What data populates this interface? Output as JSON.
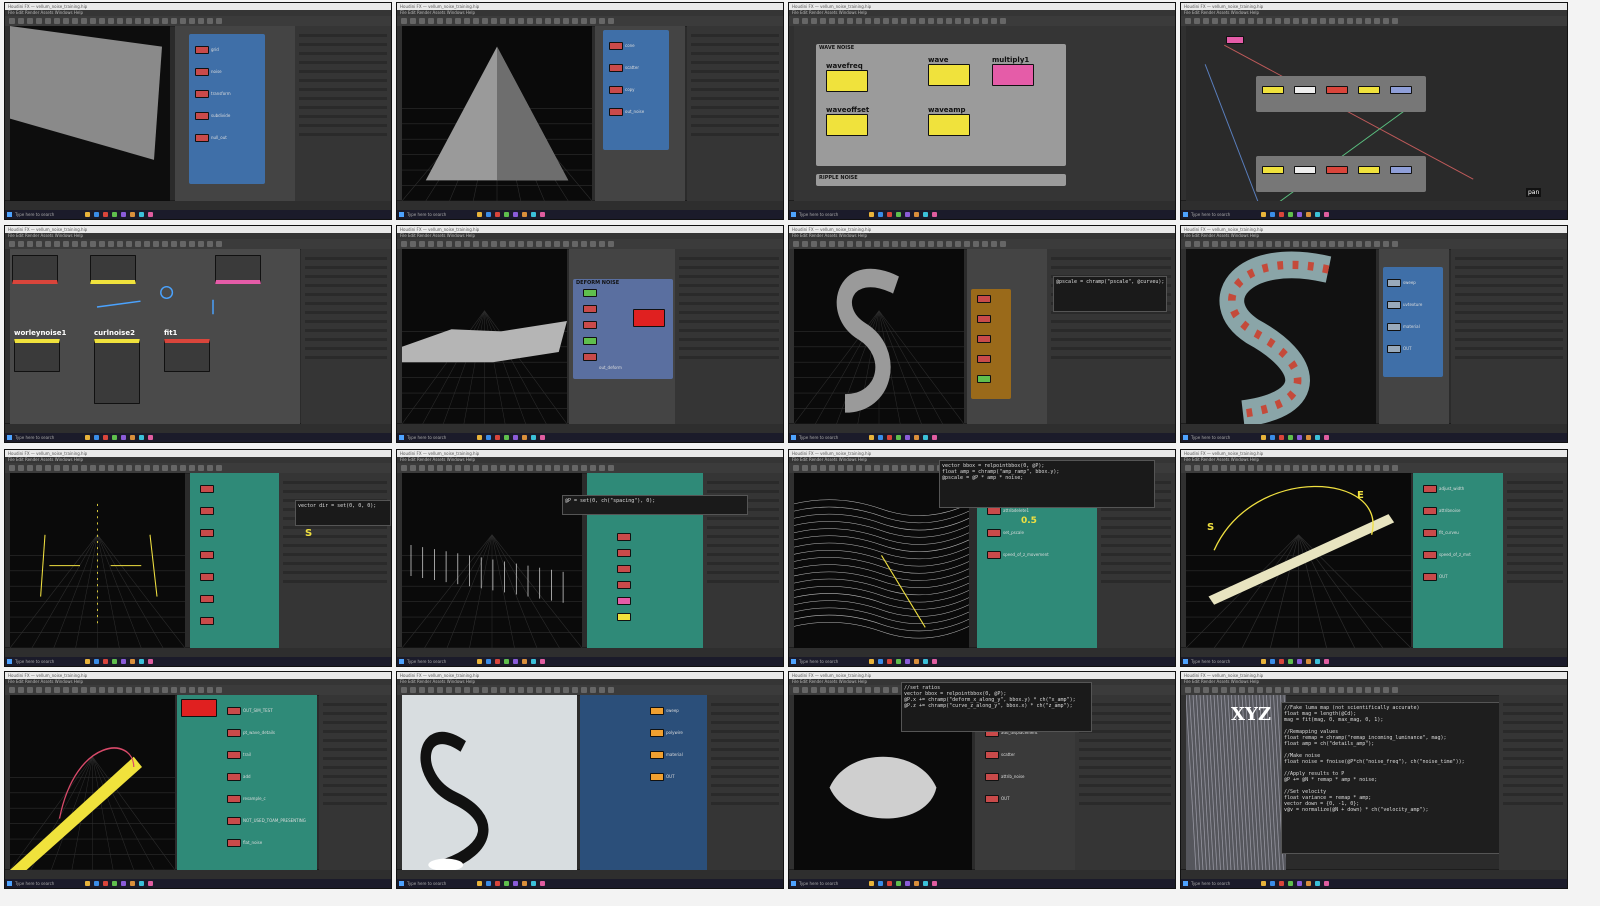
{
  "layout_note_hidden": "",
  "app_chrome": {
    "title_text": "Houdini FX — vellum_noise_training.hip",
    "menu_text": "File  Edit  Render  Assets  Windows  Help",
    "taskbar_text": "Type here to search",
    "taskbar_icon_colors": [
      "#e8b33a",
      "#3a8de8",
      "#d9453b",
      "#5fbf4d",
      "#8b5cd9",
      "#d98f3b",
      "#3bc1d9",
      "#e05da0"
    ]
  },
  "thumbs": [
    {
      "id": 1,
      "nodes": [
        "grid",
        "noise",
        "transform",
        "subdivide",
        "null_out"
      ]
    },
    {
      "id": 2,
      "nodes": [
        "cone",
        "scatter",
        "copy",
        "out_noise"
      ]
    },
    {
      "id": 3,
      "labels": [
        "WAVE NOISE",
        "wavefreq",
        "wave",
        "multiply1",
        "waveoffset",
        "waveamp",
        "RIPPLE NOISE"
      ]
    },
    {
      "id": 4,
      "label": "pan"
    },
    {
      "id": 5,
      "labels": [
        "worleynoise1",
        "curlnoise2",
        "fit1"
      ]
    },
    {
      "id": 6,
      "labels": [
        "DEFORM NOISE",
        "out_deform"
      ]
    },
    {
      "id": 7,
      "code": "@pscale = chramp(\"pscale\", @curveu);"
    },
    {
      "id": 8,
      "nodes": [
        "sweep",
        "uvtexture",
        "material",
        "OUT"
      ]
    },
    {
      "id": 9,
      "code": "vector dir = set(0, 0, 0);",
      "annotation": "S"
    },
    {
      "id": 10,
      "code": "@P = set(0, ch(\"spacing\"), 0);"
    },
    {
      "id": 11,
      "code": [
        "vector bbox = relpointbbox(0, @P);",
        "float amp = chramp(\"amp_ramp\", bbox.y);",
        "@pscale = @P * amp * noise;"
      ],
      "nodes": [
        "adjust_width",
        "attribdelete1",
        "set_pscale",
        "speed_of_z_movement"
      ],
      "annotation": "0.5"
    },
    {
      "id": 12,
      "nodes": [
        "adjust_width",
        "attribnoise",
        "fit_curveu",
        "speed_of_z_mvt",
        "OUT"
      ],
      "annotation": [
        "S",
        "E"
      ]
    },
    {
      "id": 13,
      "nodes": [
        "OUT_SIM_TEST",
        "pt_wave_details",
        "trail",
        "add",
        "resample_c",
        "NOT_USED_TOAM_PRESENTING",
        "flat_noise"
      ]
    },
    {
      "id": 14,
      "nodes": [
        "sweep",
        "polywire",
        "material",
        "OUT"
      ]
    },
    {
      "id": 15,
      "code": [
        "//set ratios",
        "vector bbox = relpointbbox(0, @P);",
        "@P.x += chramp(\"deform_x_along_y\", bbox.y) * ch(\"x_amp\");",
        "@P.z += chramp(\"curve_z_along_y\", bbox.x) * ch(\"z_amp\");"
      ],
      "nodes": [
        "set_ratios",
        "add_displacement",
        "scatter",
        "attrib_noise",
        "OUT"
      ]
    },
    {
      "id": 16,
      "code": [
        "//Fake luma map (not scientifically accurate)",
        "float mag = length(@Cd);",
        "mag = fit(mag, 0, max_mag, 0, 1);",
        "",
        "//Remapping values",
        "float remap = chramp(\"remap_incoming_luminance\", mag);",
        "float amp = ch(\"details_amp\");",
        "",
        "//Make noise",
        "float noise = fnoise(@P*ch(\"noise_freq\"), ch(\"noise_time\"));",
        "",
        "//Apply results to P",
        "@P += @N * remap * amp * noise;",
        "",
        "//Set velocity",
        "float variance = remap * amp;",
        "vector down = {0, -1, 0};",
        "v@v = normalize(@N + down) * ch(\"velocity_amp\");"
      ],
      "annotation": "XYZ"
    }
  ]
}
